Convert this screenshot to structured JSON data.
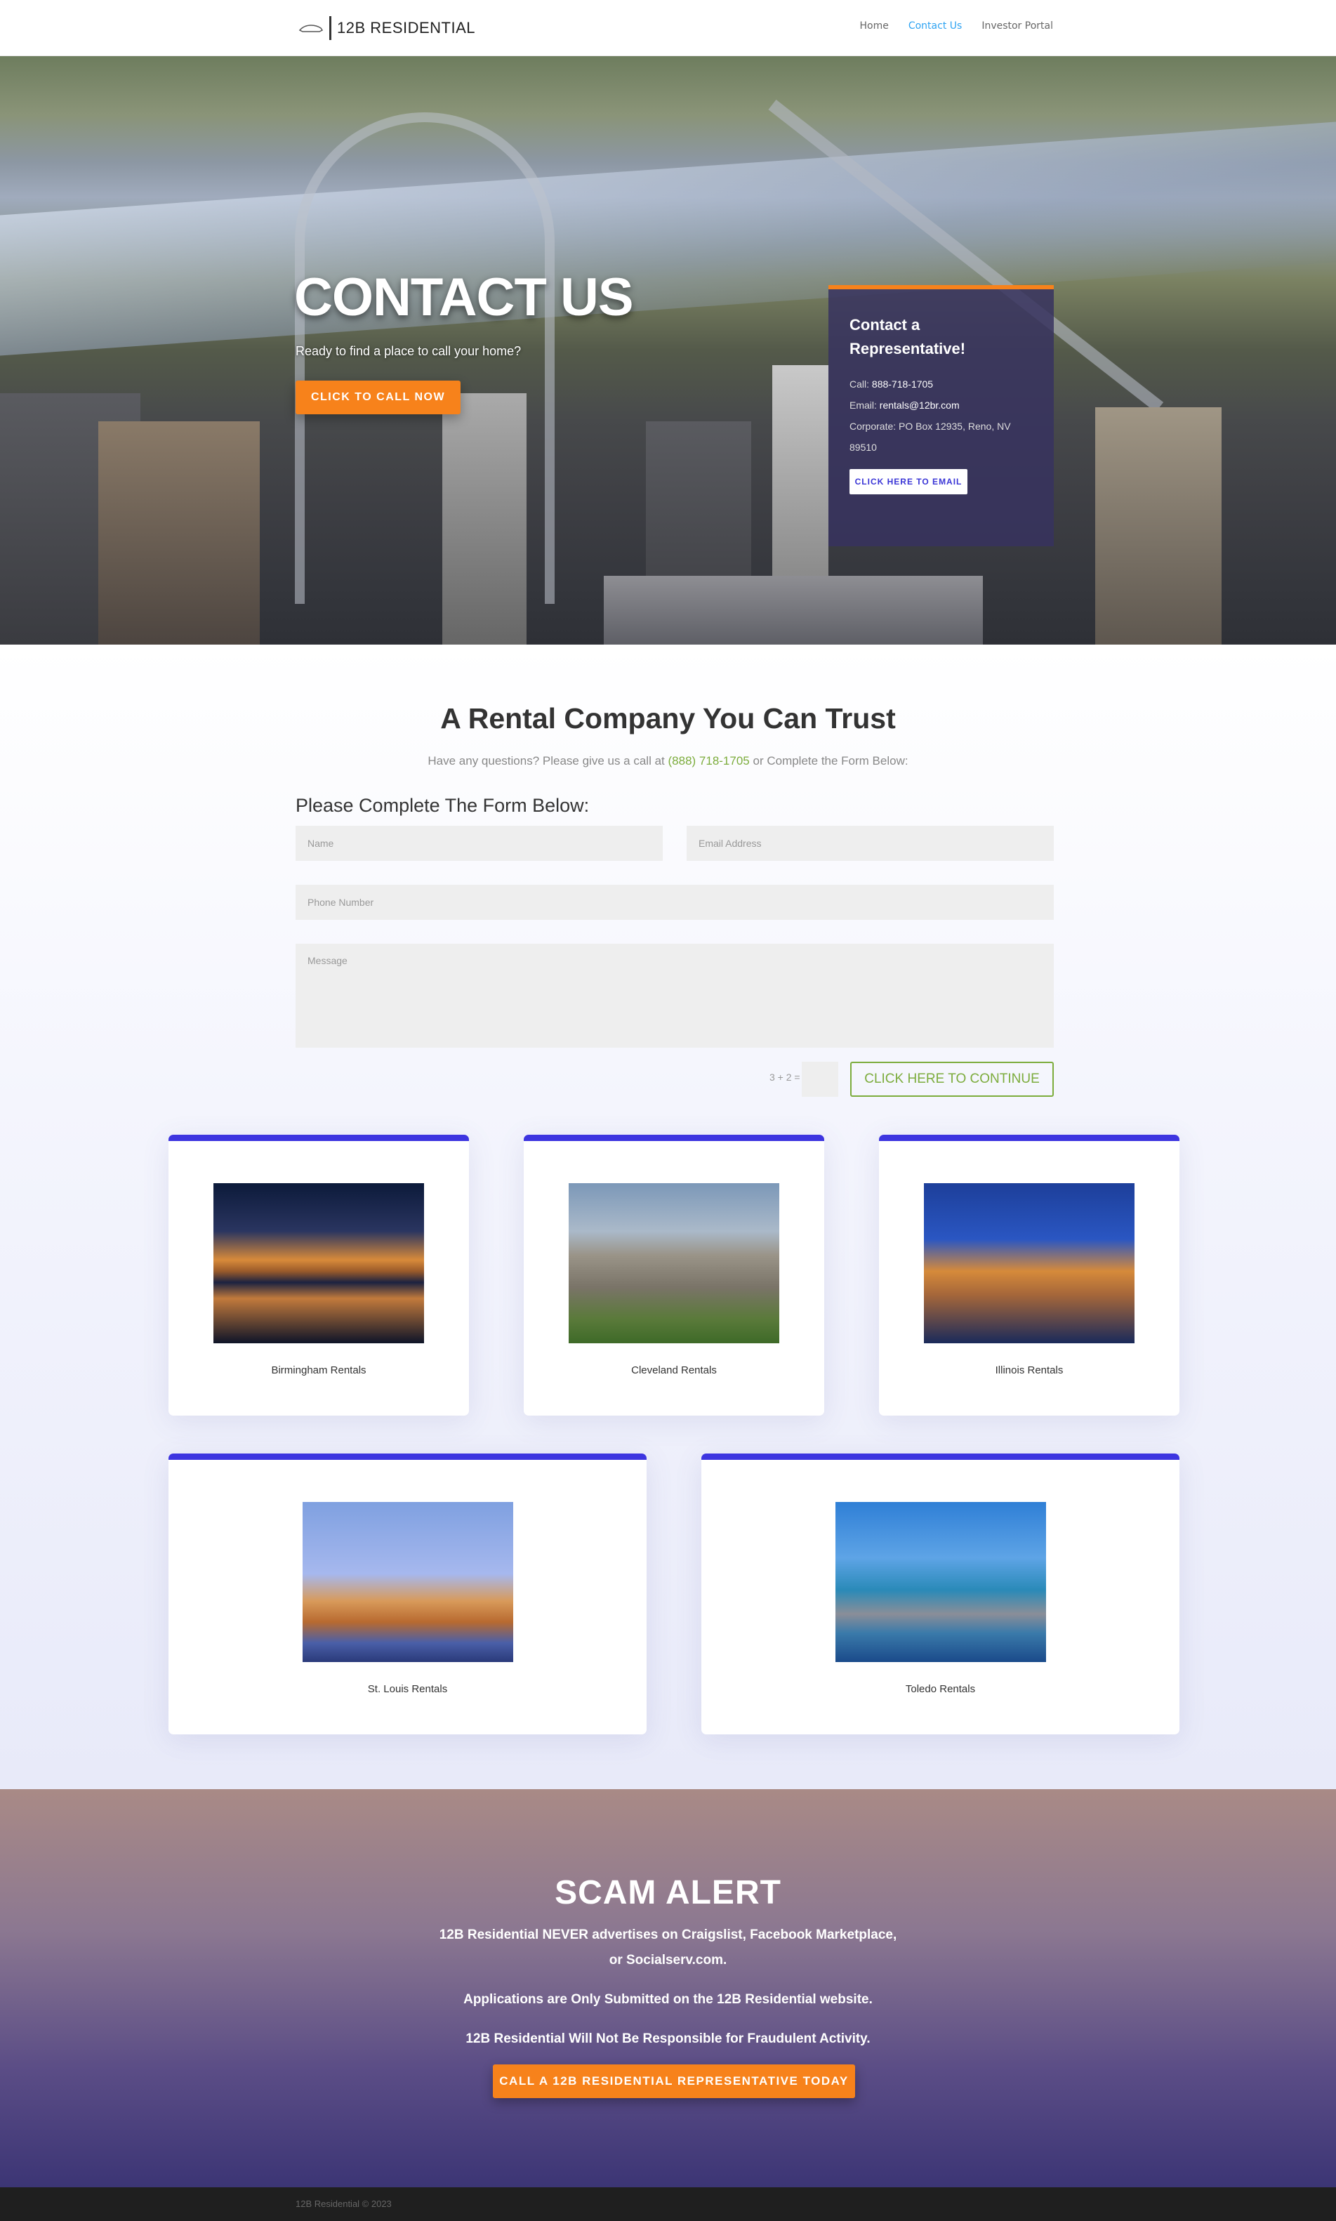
{
  "header": {
    "logo_text": "12B RESIDENTIAL",
    "nav": [
      {
        "label": "Home",
        "active": false
      },
      {
        "label": "Contact Us",
        "active": true
      },
      {
        "label": "Investor Portal",
        "active": false
      }
    ]
  },
  "hero": {
    "title": "CONTACT US",
    "subtitle": "Ready to find a place to call your home?",
    "cta": "CLICK TO CALL NOW",
    "rep_card": {
      "title": "Contact a Representative!",
      "call_label": "Call:",
      "call_value": "888-718-1705",
      "email_label": "Email:",
      "email_value": "rentals@12br.com",
      "corporate": "Corporate: PO Box 12935, Reno, NV 89510",
      "button": "CLICK HERE TO EMAIL"
    }
  },
  "main": {
    "heading": "A Rental Company You Can Trust",
    "sub_prefix": "Have any questions? Please give us a call at",
    "sub_phone": "(888) 718-1705",
    "sub_suffix": "or Complete the Form Below:",
    "form_title": "Please Complete The Form Below:",
    "form": {
      "name_placeholder": "Name",
      "email_placeholder": "Email Address",
      "phone_placeholder": "Phone Number",
      "message_placeholder": "Message",
      "captcha": "3 + 2 =",
      "submit": "CLICK HERE TO CONTINUE"
    },
    "cities": [
      {
        "label": "Birmingham Rentals"
      },
      {
        "label": "Cleveland Rentals"
      },
      {
        "label": "Illinois Rentals"
      },
      {
        "label": "St. Louis Rentals"
      },
      {
        "label": "Toledo Rentals"
      }
    ]
  },
  "scam": {
    "title": "SCAM ALERT",
    "p1": "12B Residential NEVER advertises on Craigslist, Facebook Marketplace, or Socialserv.com.",
    "p2": "Applications are Only Submitted on the 12B Residential website.",
    "p3": "12B Residential Will Not Be Responsible for Fraudulent Activity.",
    "button": "CALL A 12B RESIDENTIAL REPRESENTATIVE TODAY"
  },
  "footer": {
    "copyright": "12B Residential © 2023"
  },
  "colors": {
    "accent_orange": "#f7821b",
    "card_blue": "#3d35e0",
    "link_green": "#7cac3c",
    "nav_active": "#2ea3f2"
  }
}
